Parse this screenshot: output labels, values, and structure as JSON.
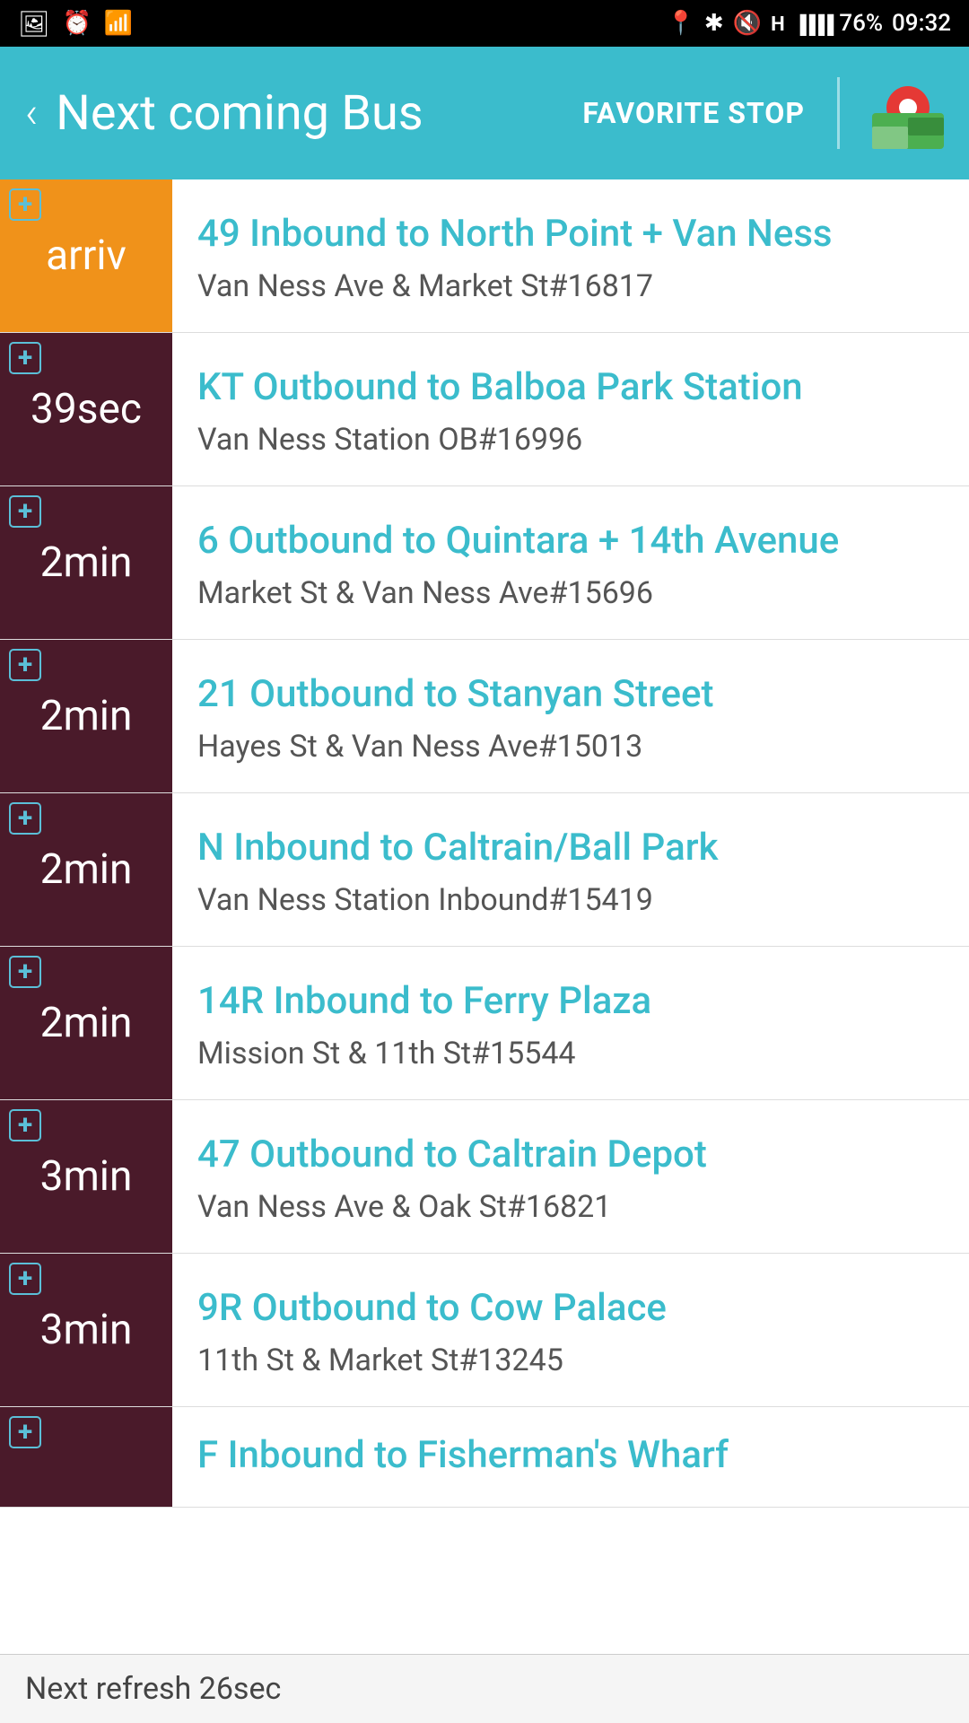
{
  "statusBar": {
    "battery": "76%",
    "time": "09:32",
    "icons": [
      "photo",
      "alarm",
      "wifi",
      "location",
      "bluetooth",
      "mute",
      "H",
      "signal"
    ]
  },
  "header": {
    "backLabel": "‹",
    "title": "Next coming Bus",
    "favoriteStopLabel": "FAVORITE STOP"
  },
  "buses": [
    {
      "timeText": "arriv",
      "color": "orange",
      "routeTitle": "49  Inbound to North Point + Van Ness",
      "stopName": "Van Ness Ave & Market St#16817"
    },
    {
      "timeText": "39sec",
      "color": "dark-red",
      "routeTitle": "KT  Outbound to Balboa Park Station",
      "stopName": "Van Ness Station OB#16996"
    },
    {
      "timeText": "2min",
      "color": "dark-red",
      "routeTitle": "6  Outbound to Quintara + 14th Avenue",
      "stopName": "Market St & Van Ness Ave#15696"
    },
    {
      "timeText": "2min",
      "color": "dark-red",
      "routeTitle": "21  Outbound to Stanyan Street",
      "stopName": "Hayes St & Van Ness Ave#15013"
    },
    {
      "timeText": "2min",
      "color": "dark-red",
      "routeTitle": "N  Inbound to Caltrain/Ball Park",
      "stopName": "Van Ness Station Inbound#15419"
    },
    {
      "timeText": "2min",
      "color": "dark-red",
      "routeTitle": "14R  Inbound to Ferry Plaza",
      "stopName": "Mission St & 11th St#15544"
    },
    {
      "timeText": "3min",
      "color": "dark-red",
      "routeTitle": "47  Outbound to Caltrain Depot",
      "stopName": "Van Ness Ave & Oak St#16821"
    },
    {
      "timeText": "3min",
      "color": "dark-red",
      "routeTitle": "9R  Outbound to Cow Palace",
      "stopName": "11th St & Market St#13245"
    },
    {
      "timeText": "",
      "color": "dark-red",
      "routeTitle": "F  Inbound to Fisherman's Wharf",
      "stopName": ""
    }
  ],
  "refreshText": "Next refresh 26sec"
}
